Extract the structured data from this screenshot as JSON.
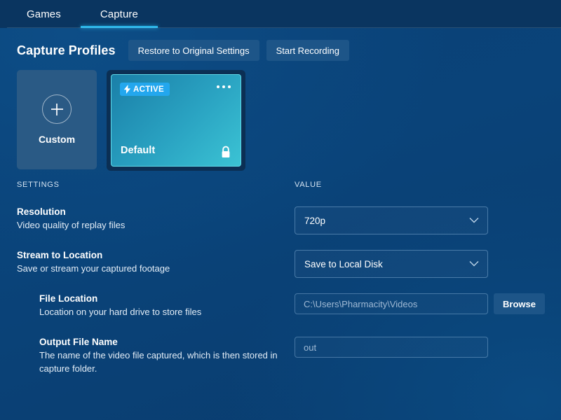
{
  "tabs": [
    {
      "label": "Games",
      "active": false
    },
    {
      "label": "Capture",
      "active": true
    }
  ],
  "header": {
    "title": "Capture Profiles",
    "restore_button": "Restore to Original Settings",
    "record_button": "Start Recording"
  },
  "profiles": {
    "custom": {
      "label": "Custom",
      "add_icon": "plus-icon"
    },
    "default": {
      "name": "Default",
      "badge": "ACTIVE",
      "badge_icon": "lightning-bolt-icon",
      "menu_icon": "more-options-icon",
      "lock_icon": "lock-icon"
    }
  },
  "table": {
    "col_settings": "SETTINGS",
    "col_value": "VALUE"
  },
  "settings": [
    {
      "title": "Resolution",
      "description": "Video quality of replay files",
      "control": "select",
      "value": "720p",
      "indent": false
    },
    {
      "title": "Stream to Location",
      "description": "Save or stream your captured footage",
      "control": "select",
      "value": "Save to Local Disk",
      "indent": false
    },
    {
      "title": "File Location",
      "description": "Location on your hard drive to store files",
      "control": "text-with-button",
      "value": "C:\\Users\\Pharmacity\\Videos",
      "button": "Browse",
      "indent": true
    },
    {
      "title": "Output File Name",
      "description": "The name of the video file captured, which is then stored in capture folder.",
      "control": "text",
      "value": "out",
      "indent": true
    }
  ],
  "colors": {
    "background": "#0a4379",
    "tabbar": "#0a3560",
    "accent": "#29b6ea",
    "badge": "#23a7ee",
    "card_custom": "#2a5a85",
    "card_active_from": "#1a7fa8",
    "card_active_to": "#3bc3d4",
    "button": "#1d5588"
  }
}
